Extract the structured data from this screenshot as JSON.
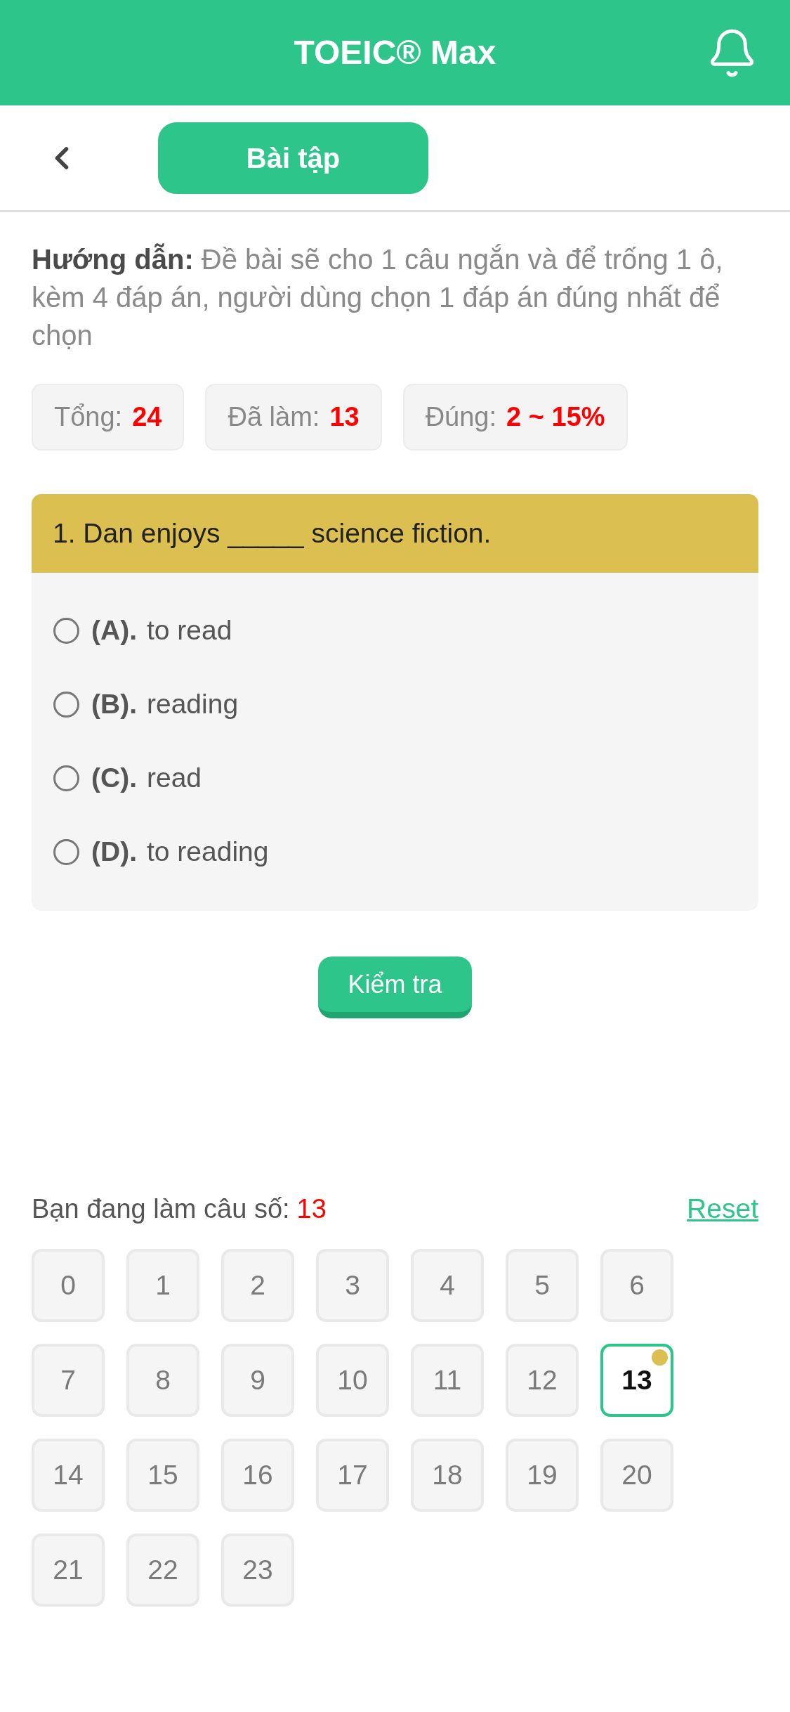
{
  "app_bar": {
    "title": "TOEIC® Max"
  },
  "toolbar": {
    "section_button": "Bài tập"
  },
  "instructions": "**Hướng dẫn:** Đề bài sẽ cho 1 câu ngắn và để trống 1 ô, kèm 4 đáp án, người dùng chọn 1 đáp án đúng nhất để chọn",
  "stats": [
    {
      "label": "Tổng:",
      "value": "24"
    },
    {
      "label": "Đã làm:",
      "value": "13"
    },
    {
      "label": "Đúng:",
      "value": "2 ~ 15%"
    }
  ],
  "question": {
    "text": "1. Dan enjoys _____ science fiction.",
    "options": [
      {
        "letter": "(A).",
        "text": "to read",
        "selected": false
      },
      {
        "letter": "(B).",
        "text": "reading",
        "selected": false
      },
      {
        "letter": "(C).",
        "text": "read",
        "selected": false
      },
      {
        "letter": "(D).",
        "text": "to reading",
        "selected": false
      }
    ]
  },
  "check_button": "Kiểm tra",
  "progress": {
    "label": "Bạn đang làm câu số:",
    "current": "13",
    "reset_link": "Reset"
  },
  "question_grid": [
    {
      "number": "0",
      "selected": false,
      "marked": false
    },
    {
      "number": "1",
      "selected": false,
      "marked": false
    },
    {
      "number": "2",
      "selected": false,
      "marked": false
    },
    {
      "number": "3",
      "selected": false,
      "marked": false
    },
    {
      "number": "4",
      "selected": false,
      "marked": false
    },
    {
      "number": "5",
      "selected": false,
      "marked": false
    },
    {
      "number": "6",
      "selected": false,
      "marked": false
    },
    {
      "number": "7",
      "selected": false,
      "marked": false
    },
    {
      "number": "8",
      "selected": false,
      "marked": false
    },
    {
      "number": "9",
      "selected": false,
      "marked": false
    },
    {
      "number": "10",
      "selected": false,
      "marked": false
    },
    {
      "number": "11",
      "selected": false,
      "marked": false
    },
    {
      "number": "12",
      "selected": false,
      "marked": false
    },
    {
      "number": "13",
      "selected": true,
      "marked": true
    },
    {
      "number": "14",
      "selected": false,
      "marked": false
    },
    {
      "number": "15",
      "selected": false,
      "marked": false
    },
    {
      "number": "16",
      "selected": false,
      "marked": false
    },
    {
      "number": "17",
      "selected": false,
      "marked": false
    },
    {
      "number": "18",
      "selected": false,
      "marked": false
    },
    {
      "number": "19",
      "selected": false,
      "marked": false
    },
    {
      "number": "20",
      "selected": false,
      "marked": false
    },
    {
      "number": "21",
      "selected": false,
      "marked": false
    },
    {
      "number": "22",
      "selected": false,
      "marked": false
    },
    {
      "number": "23",
      "selected": false,
      "marked": false
    }
  ]
}
